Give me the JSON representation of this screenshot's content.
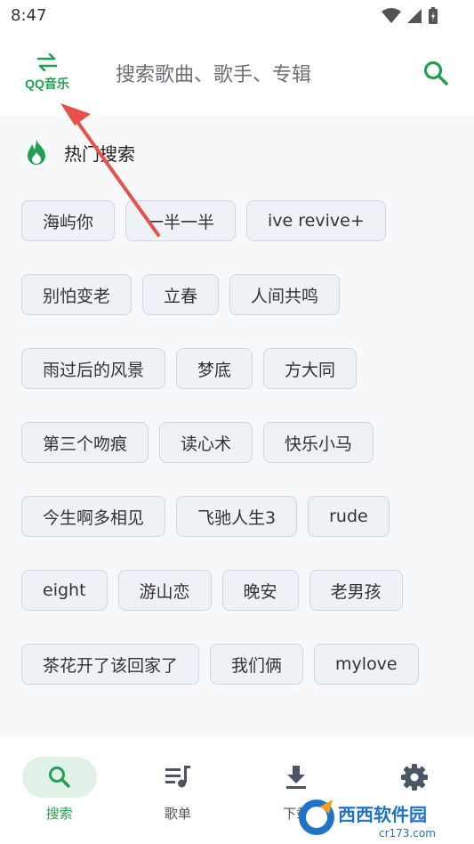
{
  "status_bar": {
    "time": "8:47"
  },
  "header": {
    "source_label": "QQ音乐",
    "search_placeholder": "搜索歌曲、歌手、专辑"
  },
  "hot_search": {
    "title": "热门搜索",
    "rows": [
      [
        "海屿你",
        "一半一半",
        "ive revive+"
      ],
      [
        "别怕变老",
        "立春",
        "人间共鸣"
      ],
      [
        "雨过后的风景",
        "梦底",
        "方大同"
      ],
      [
        "第三个吻痕",
        "读心术",
        "快乐小马"
      ],
      [
        "今生啊多相见",
        "飞驰人生3",
        "rude"
      ],
      [
        "eight",
        "游山恋",
        "晚安",
        "老男孩"
      ],
      [
        "茶花开了该回家了",
        "我们俩",
        "mylove"
      ]
    ]
  },
  "bottom_nav": {
    "items": [
      {
        "label": "搜索",
        "icon": "search-icon",
        "active": true
      },
      {
        "label": "歌单",
        "icon": "playlist-icon",
        "active": false
      },
      {
        "label": "下载",
        "icon": "download-icon",
        "active": false
      },
      {
        "label": "",
        "icon": "settings-icon",
        "active": false
      }
    ]
  },
  "watermark": {
    "text": "西西软件园",
    "subtext": "cr173.com"
  },
  "colors": {
    "accent": "#21a052",
    "annotation_arrow": "#e8514a",
    "tag_bg": "#eef1f6"
  }
}
